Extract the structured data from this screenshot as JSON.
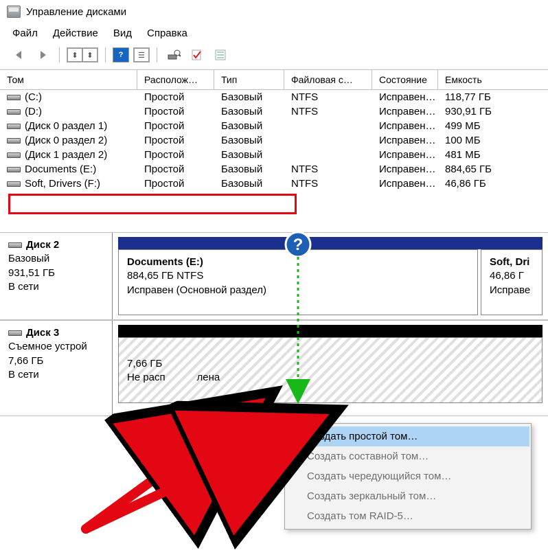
{
  "titlebar": {
    "title": "Управление дисками"
  },
  "menu": {
    "file": "Файл",
    "action": "Действие",
    "view": "Вид",
    "help": "Справка"
  },
  "columns": {
    "tom": "Том",
    "loc": "Располож…",
    "type": "Тип",
    "fs": "Файловая с…",
    "state": "Состояние",
    "cap": "Емкость"
  },
  "rows": [
    {
      "name": "(C:)",
      "loc": "Простой",
      "type": "Базовый",
      "fs": "NTFS",
      "state": "Исправен…",
      "cap": "118,77 ГБ"
    },
    {
      "name": "(D:)",
      "loc": "Простой",
      "type": "Базовый",
      "fs": "NTFS",
      "state": "Исправен…",
      "cap": "930,91 ГБ"
    },
    {
      "name": "(Диск 0 раздел 1)",
      "loc": "Простой",
      "type": "Базовый",
      "fs": "",
      "state": "Исправен…",
      "cap": "499 МБ"
    },
    {
      "name": "(Диск 0 раздел 2)",
      "loc": "Простой",
      "type": "Базовый",
      "fs": "",
      "state": "Исправен…",
      "cap": "100 МБ"
    },
    {
      "name": "(Диск 1 раздел 2)",
      "loc": "Простой",
      "type": "Базовый",
      "fs": "",
      "state": "Исправен…",
      "cap": "481 МБ"
    },
    {
      "name": "Documents (E:)",
      "loc": "Простой",
      "type": "Базовый",
      "fs": "NTFS",
      "state": "Исправен…",
      "cap": "884,65 ГБ"
    },
    {
      "name": "Soft, Drivers (F:)",
      "loc": "Простой",
      "type": "Базовый",
      "fs": "NTFS",
      "state": "Исправен…",
      "cap": "46,86 ГБ"
    }
  ],
  "disk2": {
    "label": "Диск 2",
    "type": "Базовый",
    "size": "931,51 ГБ",
    "status": "В сети",
    "p1": {
      "name": "Documents  (E:)",
      "desc": "884,65 ГБ NTFS",
      "state": "Исправен (Основной раздел)"
    },
    "p2": {
      "name": "Soft, Dri",
      "desc": "46,86 Г",
      "state": "Исправе"
    }
  },
  "disk3": {
    "label": "Диск 3",
    "type": "Съемное устрой",
    "size": "7,66 ГБ",
    "status": "В сети",
    "p1": {
      "desc": "7,66 ГБ",
      "state1": "Не расп",
      "state2": "лена"
    }
  },
  "ctx": {
    "simple": "Создать простой том…",
    "spanned": "Создать составной том…",
    "striped": "Создать чередующийся том…",
    "mirror": "Создать зеркальный том…",
    "raid5": "Создать том RAID-5…"
  }
}
